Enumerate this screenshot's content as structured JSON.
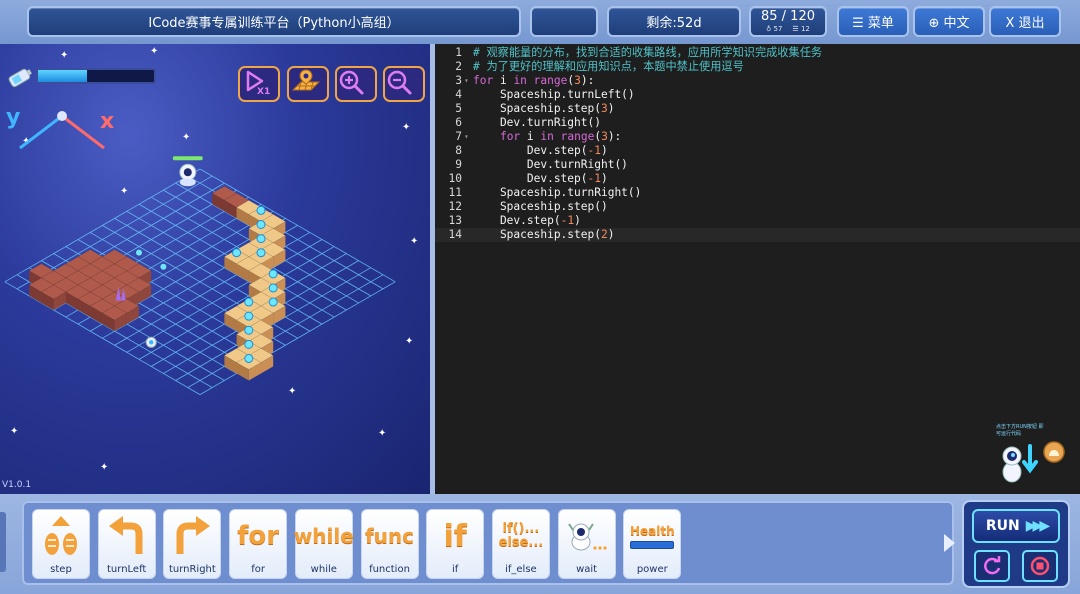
{
  "topbar": {
    "title": "ICode赛事专属训练平台（Python小高组）",
    "remaining": "剩余:52d",
    "score": "85 / 120",
    "stat1": "57",
    "stat2": "12",
    "menu": "☰ 菜单",
    "lang": "⊕ 中文",
    "exit": "X 退出"
  },
  "game": {
    "version": "V1.0.1",
    "energy_level": 0.42,
    "axis_x": "x",
    "axis_y": "y",
    "buttons": [
      "speed-x1-icon",
      "map-icon",
      "zoom-in-icon",
      "zoom-out-icon"
    ],
    "speed_label": "X1"
  },
  "editor": {
    "lines": [
      {
        "n": "1",
        "text": "# 观察能量的分布，找到合适的收集路线，应用所学知识完成收集任务"
      },
      {
        "n": "2",
        "text": "# 为了更好的理解和应用知识点，本题中禁止使用逗号"
      },
      {
        "n": "3",
        "text": "for i in range(3):"
      },
      {
        "n": "4",
        "text": "    Spaceship.turnLeft()"
      },
      {
        "n": "5",
        "text": "    Spaceship.step(3)"
      },
      {
        "n": "6",
        "text": "    Dev.turnRight()"
      },
      {
        "n": "7",
        "text": "    for i in range(3):"
      },
      {
        "n": "8",
        "text": "        Dev.step(-1)"
      },
      {
        "n": "9",
        "text": "        Dev.turnRight()"
      },
      {
        "n": "10",
        "text": "        Dev.step(-1)"
      },
      {
        "n": "11",
        "text": "    Spaceship.turnRight()"
      },
      {
        "n": "12",
        "text": "    Spaceship.step()"
      },
      {
        "n": "13",
        "text": "    Dev.step(-1)"
      },
      {
        "n": "14",
        "text": "    Spaceship.step(2)"
      }
    ],
    "hint": "点击下方RUN按钮 即可运行代码"
  },
  "blocks": [
    {
      "label": "step",
      "icon": "step-icon"
    },
    {
      "label": "turnLeft",
      "icon": "turn-left-icon"
    },
    {
      "label": "turnRight",
      "icon": "turn-right-icon"
    },
    {
      "label": "for",
      "icon": "for-icon",
      "word": "for"
    },
    {
      "label": "while",
      "icon": "while-icon",
      "word": "while"
    },
    {
      "label": "function",
      "icon": "function-icon",
      "word": "func"
    },
    {
      "label": "if",
      "icon": "if-icon",
      "word": "if"
    },
    {
      "label": "if_else",
      "icon": "if-else-icon",
      "word": "if()...",
      "word2": "else..."
    },
    {
      "label": "wait",
      "icon": "wait-icon"
    },
    {
      "label": "power",
      "icon": "power-icon",
      "word": "Health"
    }
  ],
  "run": {
    "label": "RUN"
  },
  "colors": {
    "accent": "#6fe0ff",
    "block_orange": "#f3a13a",
    "topbar_dark": "#1f3f7a"
  }
}
